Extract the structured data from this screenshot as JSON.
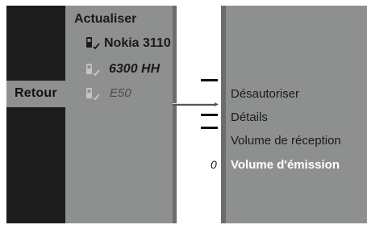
{
  "back": {
    "label": "Retour"
  },
  "devices": {
    "header": "Actualiser",
    "items": [
      {
        "label": "Nokia 3110",
        "icon": "phone-icon"
      },
      {
        "label": "6300 HH",
        "icon": "phone-icon"
      },
      {
        "label": "E50",
        "icon": "phone-icon"
      }
    ]
  },
  "menu": {
    "items": [
      {
        "label": "Désautoriser"
      },
      {
        "label": "Détails"
      },
      {
        "label": "Volume de réception"
      },
      {
        "label": "Volume d'émission",
        "value": "0",
        "selected": true
      }
    ]
  },
  "colors": {
    "panel": "#8e9090",
    "dark": "#1c1c1c",
    "highlight_text": "#ffffff"
  }
}
